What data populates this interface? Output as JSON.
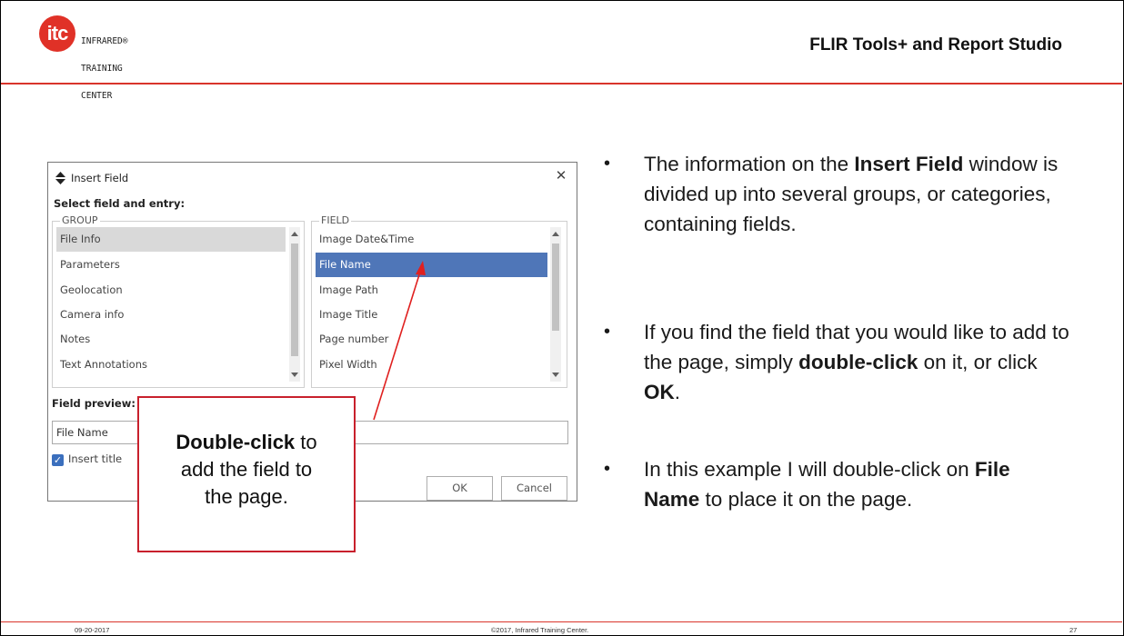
{
  "header": {
    "logo_mark": "itc",
    "logo_lines": [
      "INFRARED®",
      "TRAINING",
      "CENTER"
    ],
    "title": "FLIR Tools+ and Report Studio",
    "accent_color": "#d9342b"
  },
  "dialog": {
    "title": "Insert Field",
    "title_icon": "diamond-updown-icon",
    "close_icon": "close-icon",
    "subtitle": "Select field and entry:",
    "group": {
      "legend": "GROUP",
      "items": [
        "File Info",
        "Parameters",
        "Geolocation",
        "Camera info",
        "Notes",
        "Text Annotations"
      ],
      "selected": "File Info"
    },
    "field": {
      "legend": "FIELD",
      "items": [
        "Image Date&Time",
        "File Name",
        "Image Path",
        "Image Title",
        "Page number",
        "Pixel Width"
      ],
      "selected": "File Name"
    },
    "preview_label": "Field preview:",
    "preview_value": "File Name",
    "insert_title_label": "Insert title",
    "insert_title_checked": true,
    "ok_label": "OK",
    "cancel_label": "Cancel",
    "selection_color": "#4f76b8"
  },
  "callout": {
    "bold": "Double-click",
    "rest_line1": " to",
    "line2": "add the field to",
    "line3": "the page.",
    "border_color": "#c8202c"
  },
  "bullets": [
    {
      "parts": [
        "The information on the ",
        "Insert Field",
        " window is divided up into several groups, or categories, containing fields."
      ]
    },
    {
      "parts": [
        "If you find the field that you would like to add to the page, simply ",
        "double-click",
        " on it, or click ",
        "OK",
        "."
      ]
    },
    {
      "parts": [
        "In this example I will double-click on ",
        "File Name",
        " to place it on the page."
      ]
    }
  ],
  "footer": {
    "date": "09-20-2017",
    "copyright": "©2017, Infrared Training Center.",
    "page": "27"
  }
}
